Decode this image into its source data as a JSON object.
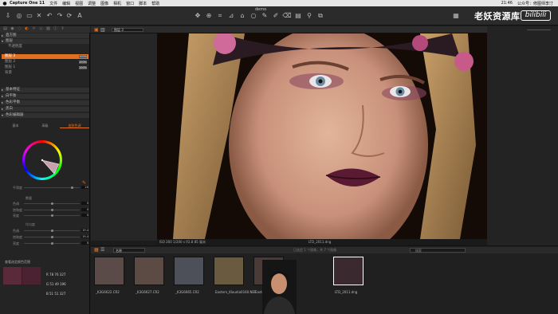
{
  "menubar": {
    "app": "Capture One 11",
    "items": [
      "文件",
      "编辑",
      "视图",
      "调整",
      "图像",
      "相机",
      "窗口",
      "脚本",
      "帮助"
    ],
    "time": "21:46",
    "account": "公众号：修图师李汀"
  },
  "window": {
    "title": "demo"
  },
  "watermark": "老妖资源库",
  "bili": "bilibili",
  "left": {
    "sections": {
      "layers": "直方图",
      "layer_panel": "图层",
      "base": "基本特征",
      "wb": "白平衡",
      "color_balance": "色彩平衡",
      "bw": "黑白",
      "color_editor": "色彩编辑器"
    },
    "opacity_label": "不透明度",
    "layers": [
      {
        "name": "图层 3",
        "pct": "100%"
      },
      {
        "name": "图层 2",
        "pct": "100%"
      },
      {
        "name": "图层 1",
        "pct": "100%"
      },
      {
        "name": "背景",
        "pct": ""
      }
    ],
    "color_tabs": [
      "基本",
      "高级",
      "皮肤色调"
    ],
    "sliders": [
      {
        "label": "平滑度",
        "value": "20"
      },
      {
        "label": "数量",
        "value": ""
      },
      {
        "label": "色调",
        "value": "0"
      },
      {
        "label": "饱和度",
        "value": "0"
      },
      {
        "label": "亮度",
        "value": "0"
      },
      {
        "label": "均匀度",
        "value": ""
      },
      {
        "label": "色调",
        "value": "19.4"
      },
      {
        "label": "饱和度",
        "value": "19.4"
      },
      {
        "label": "亮度",
        "value": "0"
      }
    ],
    "readout_label": "查看选定颜色范围",
    "readout": [
      "R 78 76 327",
      "G 51 49 196",
      "B 51 51 327"
    ]
  },
  "viewer": {
    "variant_label": "图层 3",
    "info": "ISO 200   1/200 s   f/2.8   85 毫米",
    "filename": "LTD_2011.dng"
  },
  "browser": {
    "sort": "名称",
    "status": "已选定 1 个图像，共 7 个图像",
    "search": "搜索",
    "thumbs": [
      {
        "name": "_K3G6622.CR2",
        "color": "#5a4a48"
      },
      {
        "name": "_K3G6627.CR2",
        "color": "#5c4a45"
      },
      {
        "name": "_K3G6665.CR2",
        "color": "#4d5058"
      },
      {
        "name": "Eastern_Klaudia0160.NEF",
        "color": "#6a5a40"
      },
      {
        "name": "Eastern_K...6039.NEF",
        "color": "#4a3a38"
      },
      {
        "name": "LTD_2011.dng",
        "color": "#3a2a30"
      }
    ]
  },
  "colors": {
    "accent": "#e07020"
  }
}
